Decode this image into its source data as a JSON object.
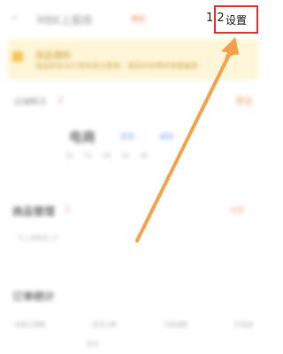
{
  "header": {
    "back_icon": "chevron-left-icon",
    "title": "MBK上报商",
    "badge": "测试",
    "version": "1.2",
    "settings_label": "设置"
  },
  "notice": {
    "title": "商品通知",
    "description": "商品状态与订单信息已更新，请及时处理并查看最新"
  },
  "section_info": {
    "label": "店铺概况",
    "tag": "2",
    "right_link": "预览",
    "stage_name": "电商",
    "link1": "查看",
    "link2": "编辑",
    "meta": [
      "32",
      "12",
      "16",
      "20",
      "06"
    ]
  },
  "section_goods": {
    "title": "商品管理",
    "tag": "2",
    "right_link": "全部",
    "subtitle": "已上架商品 12"
  },
  "section_orders": {
    "title": "订单统计",
    "row": [
      "本周订单数",
      "本月订单",
      "订单退款",
      "已完成"
    ],
    "footer": "更多"
  },
  "colors": {
    "accent": "#e03030",
    "arrow": "#f5a04a",
    "notice_bg": "#fff6d8"
  }
}
